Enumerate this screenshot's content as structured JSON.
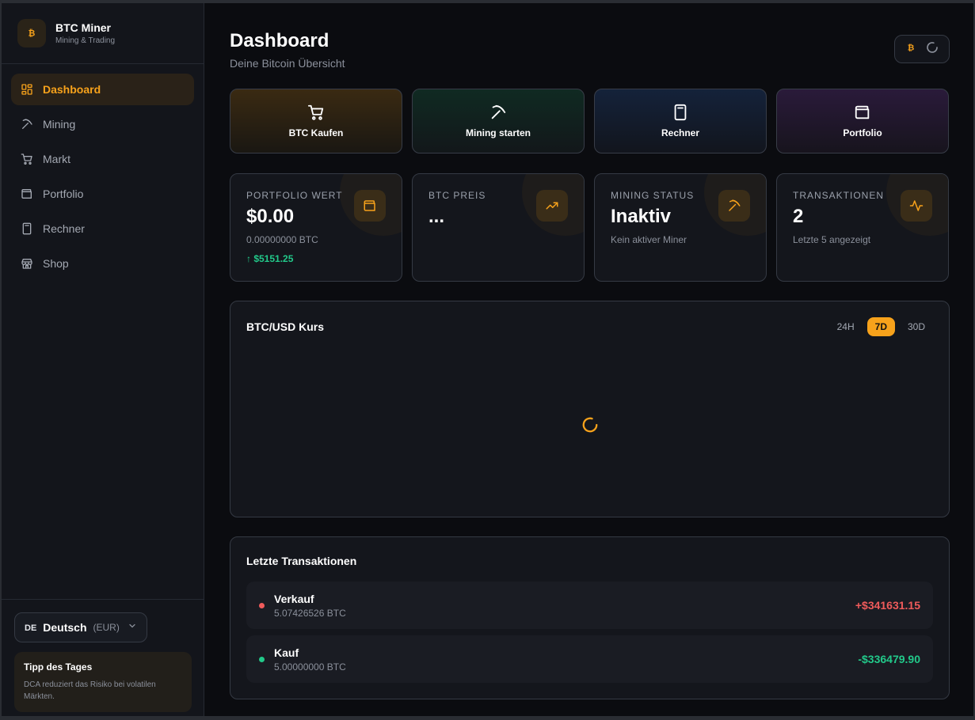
{
  "brand": {
    "title": "BTC Miner",
    "subtitle": "Mining & Trading",
    "logo_icon": "bitcoin-icon"
  },
  "nav": {
    "items": [
      {
        "label": "Dashboard",
        "icon": "dashboard-icon",
        "active": true
      },
      {
        "label": "Mining",
        "icon": "pickaxe-icon"
      },
      {
        "label": "Markt",
        "icon": "cart-icon"
      },
      {
        "label": "Portfolio",
        "icon": "wallet-icon"
      },
      {
        "label": "Rechner",
        "icon": "calculator-icon"
      },
      {
        "label": "Shop",
        "icon": "store-icon"
      }
    ]
  },
  "language": {
    "code": "DE",
    "name": "Deutsch",
    "currency": "(EUR)"
  },
  "tip": {
    "title": "Tipp des Tages",
    "text": "DCA reduziert das Risiko bei volatilen Märkten."
  },
  "header": {
    "title": "Dashboard",
    "subtitle": "Deine Bitcoin Übersicht"
  },
  "actions": [
    {
      "label": "BTC Kaufen",
      "icon": "cart-icon"
    },
    {
      "label": "Mining starten",
      "icon": "pickaxe-icon"
    },
    {
      "label": "Rechner",
      "icon": "calculator-icon"
    },
    {
      "label": "Portfolio",
      "icon": "wallet-icon"
    }
  ],
  "stats": [
    {
      "label": "Portfolio Wert",
      "value": "$0.00",
      "sub": "0.00000000 BTC",
      "delta": "↑ $5151.25",
      "icon": "wallet-icon"
    },
    {
      "label": "BTC Preis",
      "value": "...",
      "icon": "trending-up-icon"
    },
    {
      "label": "Mining Status",
      "value": "Inaktiv",
      "sub": "Kein aktiver Miner",
      "icon": "pickaxe-icon"
    },
    {
      "label": "Transaktionen",
      "value": "2",
      "sub": "Letzte 5 angezeigt",
      "icon": "activity-icon"
    }
  ],
  "chart": {
    "title": "BTC/USD Kurs",
    "ranges": [
      "24H",
      "7D",
      "30D"
    ],
    "active_range": "7D"
  },
  "transactions": {
    "title": "Letzte Transaktionen",
    "items": [
      {
        "type": "Verkauf",
        "amount": "5.07426526 BTC",
        "value": "+$341631.15",
        "color": "#f05b5b"
      },
      {
        "type": "Kauf",
        "amount": "5.00000000 BTC",
        "value": "-$336479.90",
        "color": "#22c98a"
      }
    ]
  },
  "colors": {
    "accent": "#f7a21b",
    "positive": "#22c98a",
    "negative": "#f05b5b"
  }
}
